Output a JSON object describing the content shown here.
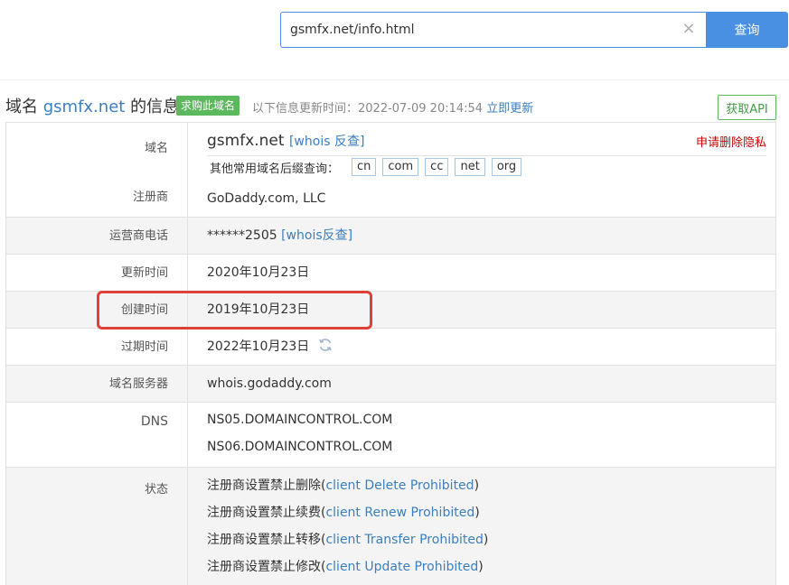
{
  "search": {
    "value": "gsmfx.net/info.html",
    "clear_symbol": "×",
    "button_label": "查询"
  },
  "header": {
    "title_prefix": "域名",
    "title_domain": "gsmfx.net",
    "title_suffix": "的信息",
    "buy_badge": "求购此域名",
    "update_info": "以下信息更新时间：2022-07-09 20:14:54",
    "update_now": "立即更新",
    "api_button": "获取API"
  },
  "domain_row": {
    "label": "域名",
    "domain": "gsmfx.net",
    "whois_link": "[whois 反查]",
    "privacy_link": "申请删除隐私",
    "suffix_label": "其他常用域名后缀查询：",
    "suffixes": [
      "cn",
      "com",
      "cc",
      "net",
      "org"
    ],
    "registrar_label": "注册商",
    "registrar_value": "GoDaddy.com, LLC"
  },
  "rows": {
    "phone": {
      "label": "运营商电话",
      "value": "******2505",
      "link": "[whois反查]"
    },
    "updated": {
      "label": "更新时间",
      "value": "2020年10月23日"
    },
    "created": {
      "label": "创建时间",
      "value": "2019年10月23日"
    },
    "expires": {
      "label": "过期时间",
      "value": "2022年10月23日"
    },
    "nameserver": {
      "label": "域名服务器",
      "value": "whois.godaddy.com"
    },
    "dns": {
      "label": "DNS",
      "values": [
        "NS05.DOMAINCONTROL.COM",
        "NS06.DOMAINCONTROL.COM"
      ]
    },
    "status": {
      "label": "状态",
      "items": [
        {
          "text": "注册商设置禁止删除",
          "code": "client Delete Prohibited"
        },
        {
          "text": "注册商设置禁止续费",
          "code": "client Renew Prohibited"
        },
        {
          "text": "注册商设置禁止转移",
          "code": "client Transfer Prohibited"
        },
        {
          "text": "注册商设置禁止修改",
          "code": "client Update Prohibited"
        }
      ]
    }
  },
  "colors": {
    "accent": "#4a90e2",
    "link": "#3a7fc1",
    "badge_green": "#5cb85c",
    "highlight_red": "#e0403a",
    "privacy_red": "#cc0000"
  }
}
